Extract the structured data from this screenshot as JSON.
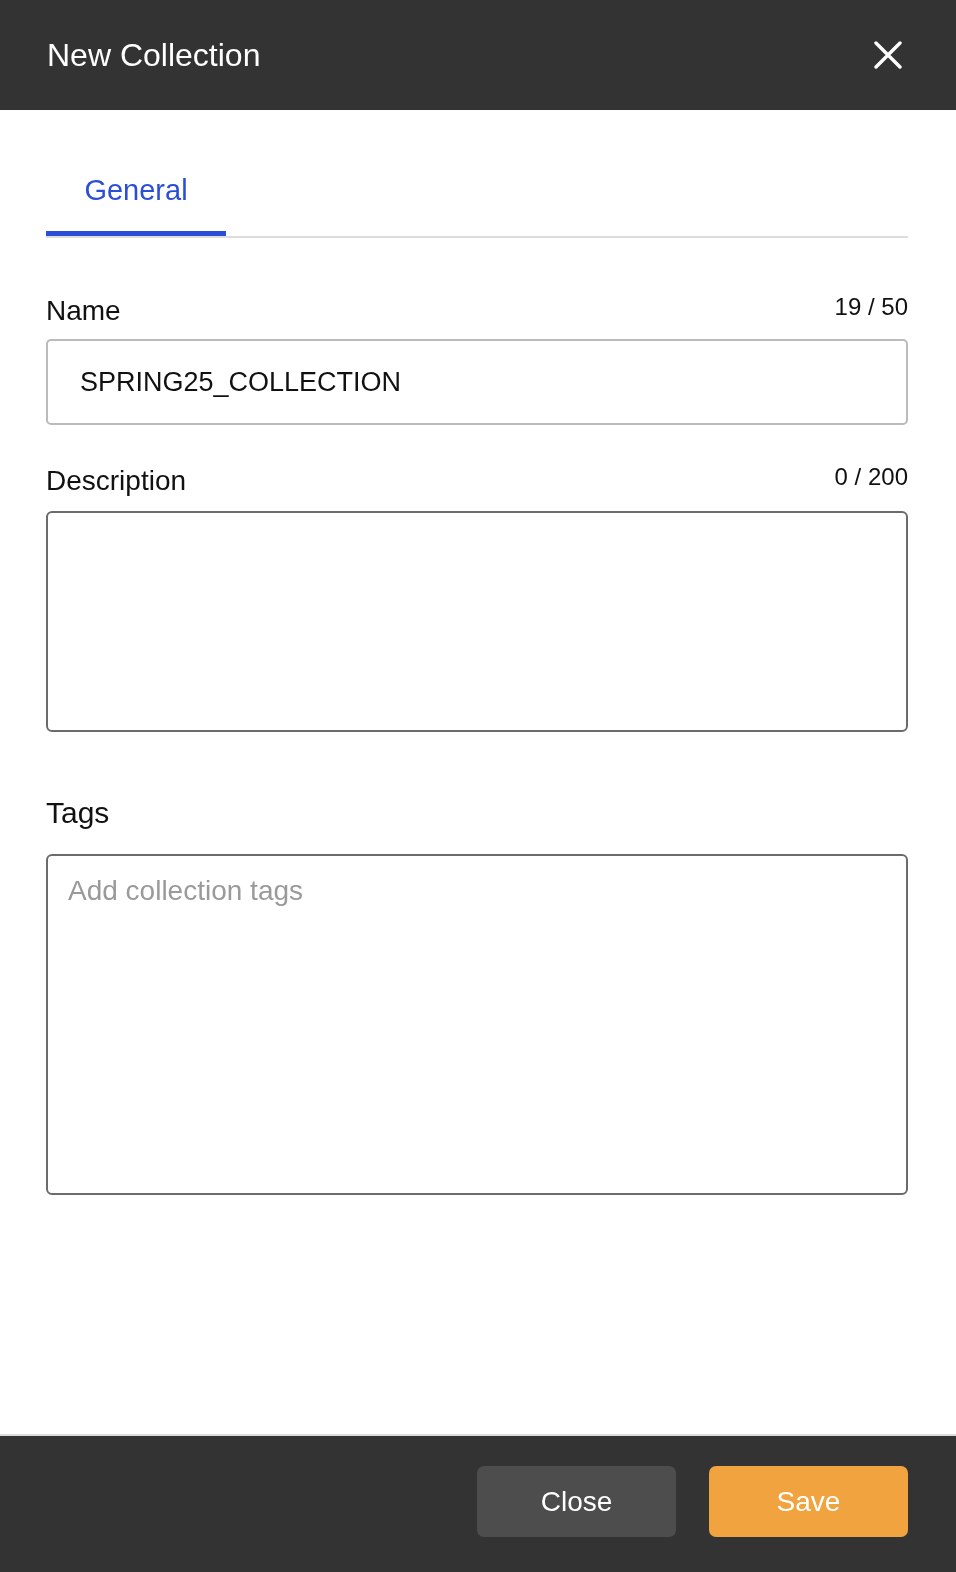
{
  "dialog": {
    "title": "New Collection"
  },
  "tabs": [
    {
      "label": "General",
      "selected": true
    }
  ],
  "fields": [
    {
      "kind": "input",
      "label": "Name",
      "counter": "19 / 50",
      "value": "SPRING25_COLLECTION"
    },
    {
      "kind": "textarea",
      "label": "Description",
      "counter": "0 / 200"
    },
    {
      "kind": "tags",
      "label": "Tags",
      "placeholder": "Add collection tags"
    }
  ],
  "buttons": [
    {
      "kind": "secondary",
      "label": "Close"
    },
    {
      "kind": "primary",
      "label": "Save"
    }
  ]
}
